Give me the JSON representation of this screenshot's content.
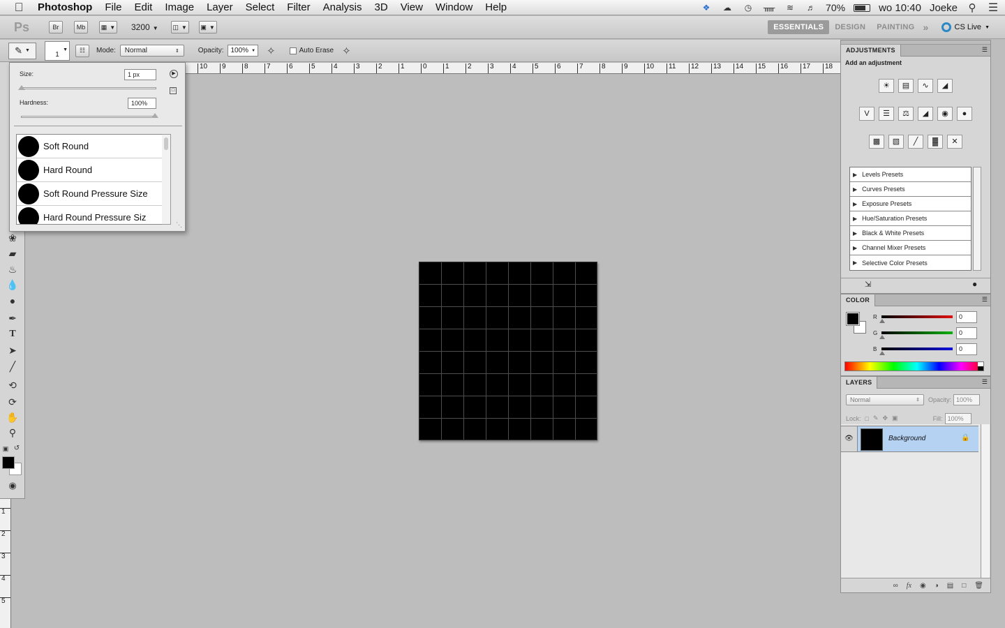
{
  "menubar": {
    "app": "Photoshop",
    "items": [
      "File",
      "Edit",
      "Image",
      "Layer",
      "Select",
      "Filter",
      "Analysis",
      "3D",
      "View",
      "Window",
      "Help"
    ],
    "battery": "70%",
    "clock": "wo 10:40",
    "user": "Joeke"
  },
  "appbar": {
    "logo": "Ps",
    "bridge": "Br",
    "minibridge": "Mb",
    "zoom": "3200",
    "workspaces": [
      "ESSENTIALS",
      "DESIGN",
      "PAINTING"
    ],
    "more": "»",
    "cslive": "CS Live"
  },
  "options": {
    "brush_size_preview": "1",
    "mode_label": "Mode:",
    "mode_value": "Normal",
    "opacity_label": "Opacity:",
    "opacity_value": "100%",
    "auto_erase_label": "Auto Erase",
    "auto_erase_checked": false
  },
  "ruler": {
    "top_ticks": [
      "10",
      "9",
      "8",
      "7",
      "6",
      "5",
      "4",
      "3",
      "2",
      "1",
      "0",
      "1",
      "2",
      "3",
      "4",
      "5",
      "6",
      "7",
      "8",
      "9",
      "10",
      "11",
      "12",
      "13",
      "14",
      "15",
      "16",
      "17",
      "18"
    ],
    "left_ticks": [
      "1",
      "2",
      "3",
      "4",
      "5"
    ]
  },
  "brush_popup": {
    "size_label": "Size:",
    "size_value": "1 px",
    "hardness_label": "Hardness:",
    "hardness_value": "100%",
    "brushes": [
      "Soft Round",
      "Hard Round",
      "Soft Round Pressure Size",
      "Hard Round Pressure Siz"
    ]
  },
  "adjustments": {
    "tab": "ADJUSTMENTS",
    "subtitle": "Add an adjustment",
    "icons_row1": [
      "brightness-icon",
      "levels-icon",
      "curves-icon",
      "exposure-icon"
    ],
    "icons_row2": [
      "vibrance-icon",
      "hue-saturation-icon",
      "color-balance-icon",
      "black-white-icon",
      "photo-filter-icon",
      "channel-mixer-icon"
    ],
    "icons_row3": [
      "invert-icon",
      "posterize-icon",
      "threshold-icon",
      "gradient-map-icon",
      "selective-color-icon"
    ],
    "presets": [
      "Levels Presets",
      "Curves Presets",
      "Exposure Presets",
      "Hue/Saturation Presets",
      "Black & White Presets",
      "Channel Mixer Presets",
      "Selective Color Presets"
    ]
  },
  "color": {
    "tab": "COLOR",
    "channels": [
      {
        "label": "R",
        "value": "0",
        "color": "#e01010"
      },
      {
        "label": "G",
        "value": "0",
        "color": "#10b010"
      },
      {
        "label": "B",
        "value": "0",
        "color": "#1010e0"
      }
    ]
  },
  "layers": {
    "tab": "LAYERS",
    "blend_mode": "Normal",
    "opacity_label": "Opacity:",
    "opacity_value": "100%",
    "lock_label": "Lock:",
    "fill_label": "Fill:",
    "fill_value": "100%",
    "layer_name": "Background"
  },
  "colors": {
    "selection_blue": "#b5d2f3",
    "cslive_blue": "#2b87c6"
  }
}
